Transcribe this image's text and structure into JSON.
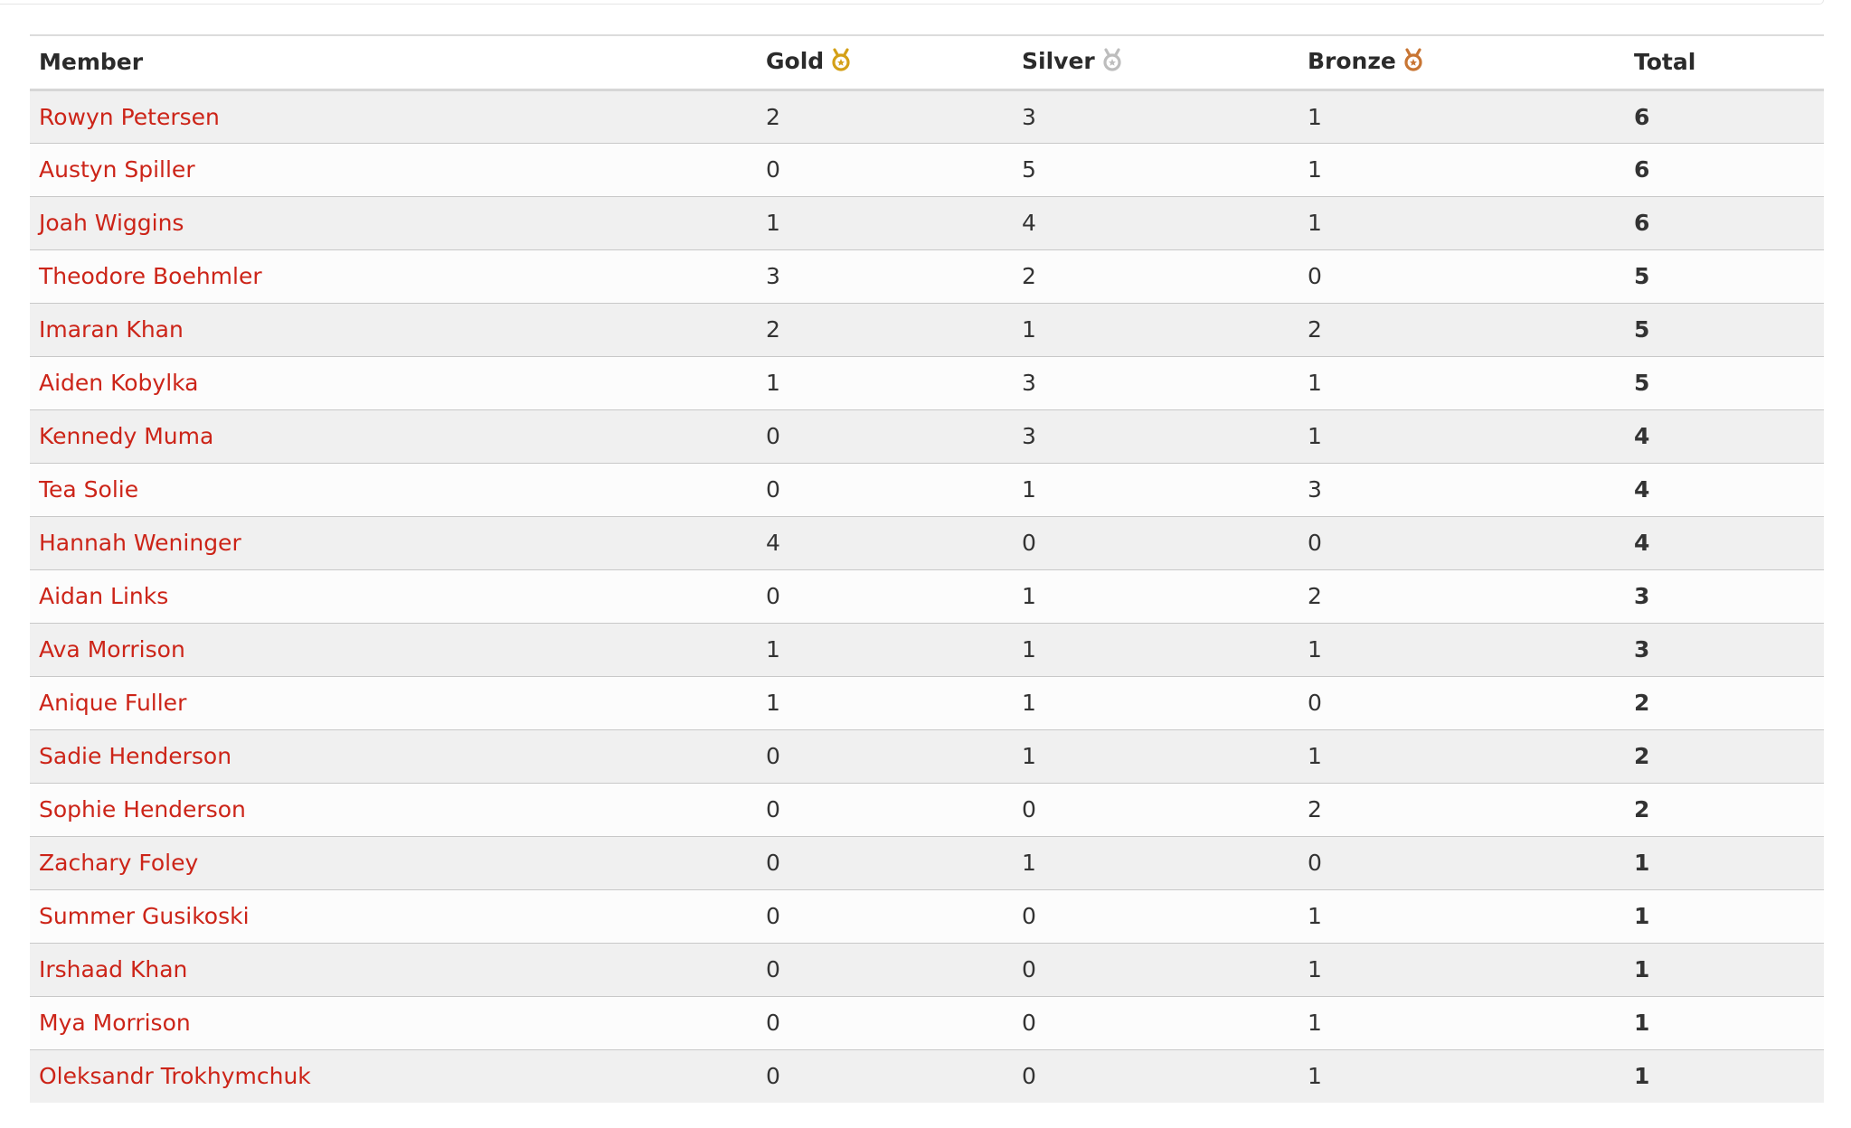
{
  "colors": {
    "link": "#cc2418",
    "gold": "#d4a017",
    "silver": "#bdbdbd",
    "bronze": "#c87533",
    "row_alt": "#f0f0f0"
  },
  "table": {
    "headers": {
      "member": "Member",
      "gold": "Gold",
      "silver": "Silver",
      "bronze": "Bronze",
      "total": "Total"
    },
    "header_icons": {
      "gold": "gold-medal-icon",
      "silver": "silver-medal-icon",
      "bronze": "bronze-medal-icon"
    },
    "rows": [
      {
        "member": "Rowyn Petersen",
        "gold": "2",
        "silver": "3",
        "bronze": "1",
        "total": "6"
      },
      {
        "member": "Austyn Spiller",
        "gold": "0",
        "silver": "5",
        "bronze": "1",
        "total": "6"
      },
      {
        "member": "Joah Wiggins",
        "gold": "1",
        "silver": "4",
        "bronze": "1",
        "total": "6"
      },
      {
        "member": "Theodore Boehmler",
        "gold": "3",
        "silver": "2",
        "bronze": "0",
        "total": "5"
      },
      {
        "member": "Imaran Khan",
        "gold": "2",
        "silver": "1",
        "bronze": "2",
        "total": "5"
      },
      {
        "member": "Aiden Kobylka",
        "gold": "1",
        "silver": "3",
        "bronze": "1",
        "total": "5"
      },
      {
        "member": "Kennedy Muma",
        "gold": "0",
        "silver": "3",
        "bronze": "1",
        "total": "4"
      },
      {
        "member": "Tea Solie",
        "gold": "0",
        "silver": "1",
        "bronze": "3",
        "total": "4"
      },
      {
        "member": "Hannah Weninger",
        "gold": "4",
        "silver": "0",
        "bronze": "0",
        "total": "4"
      },
      {
        "member": "Aidan Links",
        "gold": "0",
        "silver": "1",
        "bronze": "2",
        "total": "3"
      },
      {
        "member": "Ava Morrison",
        "gold": "1",
        "silver": "1",
        "bronze": "1",
        "total": "3"
      },
      {
        "member": "Anique Fuller",
        "gold": "1",
        "silver": "1",
        "bronze": "0",
        "total": "2"
      },
      {
        "member": "Sadie Henderson",
        "gold": "0",
        "silver": "1",
        "bronze": "1",
        "total": "2"
      },
      {
        "member": "Sophie Henderson",
        "gold": "0",
        "silver": "0",
        "bronze": "2",
        "total": "2"
      },
      {
        "member": "Zachary Foley",
        "gold": "0",
        "silver": "1",
        "bronze": "0",
        "total": "1"
      },
      {
        "member": "Summer Gusikoski",
        "gold": "0",
        "silver": "0",
        "bronze": "1",
        "total": "1"
      },
      {
        "member": "Irshaad Khan",
        "gold": "0",
        "silver": "0",
        "bronze": "1",
        "total": "1"
      },
      {
        "member": "Mya Morrison",
        "gold": "0",
        "silver": "0",
        "bronze": "1",
        "total": "1"
      },
      {
        "member": "Oleksandr Trokhymchuk",
        "gold": "0",
        "silver": "0",
        "bronze": "1",
        "total": "1"
      }
    ]
  }
}
